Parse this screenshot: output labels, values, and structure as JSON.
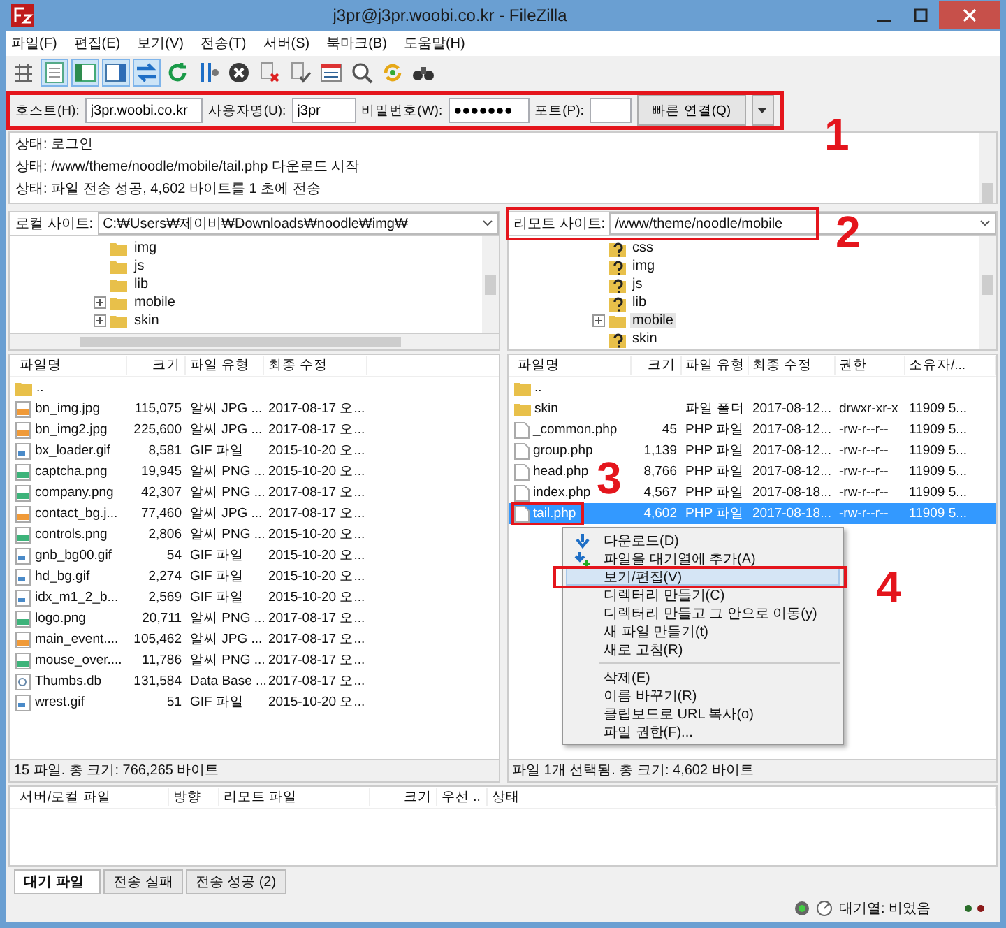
{
  "window": {
    "title": "j3pr@j3pr.woobi.co.kr - FileZilla"
  },
  "menu": [
    "파일(F)",
    "편집(E)",
    "보기(V)",
    "전송(T)",
    "서버(S)",
    "북마크(B)",
    "도움말(H)"
  ],
  "toolbar": [
    {
      "kind": "sites",
      "pressed": false
    },
    {
      "kind": "log",
      "pressed": true
    },
    {
      "kind": "localtree",
      "pressed": true
    },
    {
      "kind": "remotetree",
      "pressed": true
    },
    {
      "kind": "queue",
      "pressed": true
    },
    {
      "kind": "refresh",
      "pressed": false
    },
    {
      "kind": "process",
      "pressed": false
    },
    {
      "kind": "cancel",
      "pressed": false
    },
    {
      "kind": "disconnect",
      "pressed": false
    },
    {
      "kind": "reconnect",
      "pressed": false
    },
    {
      "kind": "filter",
      "pressed": false
    },
    {
      "kind": "compare",
      "pressed": false
    },
    {
      "kind": "sync",
      "pressed": false
    },
    {
      "kind": "find",
      "pressed": false
    }
  ],
  "quickconnect": {
    "fields": [
      {
        "label": "호스트(H):",
        "value": "j3pr.woobi.co.kr"
      },
      {
        "label": "사용자명(U):",
        "value": "j3pr"
      },
      {
        "label": "비밀번호(W):",
        "value": "●●●●●●●"
      },
      {
        "label": "포트(P):"
      }
    ],
    "button": "빠른 연결(Q)"
  },
  "log": [
    {
      "prefix": "상태:",
      "text": "로그인"
    },
    {
      "prefix": "상태:",
      "text": "/www/theme/noodle/mobile/tail.php 다운로드 시작"
    },
    {
      "prefix": "상태:",
      "text": "파일 전송 성공, 4,602 바이트를 1 초에 전송"
    }
  ],
  "local": {
    "label": "로컬 사이트:",
    "path": "C:₩Users₩제이비₩Downloads₩noodle₩img₩",
    "tree": [
      {
        "name": "img",
        "kind": "folder",
        "expandable": false,
        "selected": false
      },
      {
        "name": "js",
        "kind": "folder",
        "expandable": false,
        "selected": false
      },
      {
        "name": "lib",
        "kind": "folder",
        "expandable": false,
        "selected": false
      },
      {
        "name": "mobile",
        "kind": "folder",
        "expandable": true,
        "selected": false
      },
      {
        "name": "skin",
        "kind": "folder",
        "expandable": true,
        "selected": false
      }
    ],
    "columns": [
      "파일명",
      "크기",
      "파일 유형",
      "최종 수정"
    ],
    "rows": [
      {
        "kind": "folder",
        "cells": [
          ".."
        ],
        "selected": false
      },
      {
        "kind": "jpg",
        "cells": [
          "bn_img.jpg",
          "115,075",
          "알씨 JPG ...",
          "2017-08-17 오..."
        ],
        "selected": false
      },
      {
        "kind": "jpg",
        "cells": [
          "bn_img2.jpg",
          "225,600",
          "알씨 JPG ...",
          "2017-08-17 오..."
        ],
        "selected": false
      },
      {
        "kind": "gif",
        "cells": [
          "bx_loader.gif",
          "8,581",
          "GIF 파일",
          "2015-10-20 오..."
        ],
        "selected": false
      },
      {
        "kind": "png",
        "cells": [
          "captcha.png",
          "19,945",
          "알씨 PNG ...",
          "2015-10-20 오..."
        ],
        "selected": false
      },
      {
        "kind": "png",
        "cells": [
          "company.png",
          "42,307",
          "알씨 PNG ...",
          "2017-08-17 오..."
        ],
        "selected": false
      },
      {
        "kind": "jpg",
        "cells": [
          "contact_bg.j...",
          "77,460",
          "알씨 JPG ...",
          "2017-08-17 오..."
        ],
        "selected": false
      },
      {
        "kind": "png",
        "cells": [
          "controls.png",
          "2,806",
          "알씨 PNG ...",
          "2015-10-20 오..."
        ],
        "selected": false
      },
      {
        "kind": "gif",
        "cells": [
          "gnb_bg00.gif",
          "54",
          "GIF 파일",
          "2015-10-20 오..."
        ],
        "selected": false
      },
      {
        "kind": "gif",
        "cells": [
          "hd_bg.gif",
          "2,274",
          "GIF 파일",
          "2015-10-20 오..."
        ],
        "selected": false
      },
      {
        "kind": "gif",
        "cells": [
          "idx_m1_2_b...",
          "2,569",
          "GIF 파일",
          "2015-10-20 오..."
        ],
        "selected": false
      },
      {
        "kind": "png",
        "cells": [
          "logo.png",
          "20,711",
          "알씨 PNG ...",
          "2017-08-17 오..."
        ],
        "selected": false
      },
      {
        "kind": "jpg",
        "cells": [
          "main_event....",
          "105,462",
          "알씨 JPG ...",
          "2017-08-17 오..."
        ],
        "selected": false
      },
      {
        "kind": "png",
        "cells": [
          "mouse_over....",
          "11,786",
          "알씨 PNG ...",
          "2017-08-17 오..."
        ],
        "selected": false
      },
      {
        "kind": "db",
        "cells": [
          "Thumbs.db",
          "131,584",
          "Data Base ...",
          "2017-08-17 오..."
        ],
        "selected": false
      },
      {
        "kind": "gif",
        "cells": [
          "wrest.gif",
          "51",
          "GIF 파일",
          "2015-10-20 오..."
        ],
        "selected": false
      }
    ],
    "status": "15 파일. 총 크기: 766,265 바이트"
  },
  "remote": {
    "label": "리모트 사이트:",
    "path": "/www/theme/noodle/mobile",
    "tree": [
      {
        "name": "css",
        "kind": "unknown",
        "expandable": false,
        "selected": false
      },
      {
        "name": "img",
        "kind": "unknown",
        "expandable": false,
        "selected": false
      },
      {
        "name": "js",
        "kind": "unknown",
        "expandable": false,
        "selected": false
      },
      {
        "name": "lib",
        "kind": "unknown",
        "expandable": false,
        "selected": false
      },
      {
        "name": "mobile",
        "kind": "folder",
        "expandable": true,
        "selected": true
      },
      {
        "name": "skin",
        "kind": "unknown",
        "expandable": false,
        "selected": false
      }
    ],
    "columns": [
      "파일명",
      "크기",
      "파일 유형",
      "최종 수정",
      "권한",
      "소유자/..."
    ],
    "rows": [
      {
        "kind": "folder",
        "cells": [
          ".."
        ],
        "selected": false
      },
      {
        "kind": "folder",
        "cells": [
          "skin",
          "",
          "파일 폴더",
          "2017-08-12...",
          "drwxr-xr-x",
          "11909 5..."
        ],
        "selected": false
      },
      {
        "kind": "php",
        "cells": [
          "_common.php",
          "45",
          "PHP 파일",
          "2017-08-12...",
          "-rw-r--r--",
          "11909 5..."
        ],
        "selected": false
      },
      {
        "kind": "php",
        "cells": [
          "group.php",
          "1,139",
          "PHP 파일",
          "2017-08-12...",
          "-rw-r--r--",
          "11909 5..."
        ],
        "selected": false
      },
      {
        "kind": "php",
        "cells": [
          "head.php",
          "8,766",
          "PHP 파일",
          "2017-08-12...",
          "-rw-r--r--",
          "11909 5..."
        ],
        "selected": false
      },
      {
        "kind": "php",
        "cells": [
          "index.php",
          "4,567",
          "PHP 파일",
          "2017-08-18...",
          "-rw-r--r--",
          "11909 5..."
        ],
        "selected": false
      },
      {
        "kind": "php",
        "cells": [
          "tail.php",
          "4,602",
          "PHP 파일",
          "2017-08-18...",
          "-rw-r--r--",
          "11909 5..."
        ],
        "selected": true
      }
    ],
    "status": "파일 1개 선택됨. 총 크기: 4,602 바이트"
  },
  "context_menu": [
    {
      "kind": "download",
      "label": "다운로드(D)",
      "selected": false
    },
    {
      "kind": "queue",
      "label": "파일을 대기열에 추가(A)",
      "selected": false
    },
    {
      "kind": "item",
      "label": "보기/편집(V)",
      "selected": true
    },
    {
      "kind": "item",
      "label": "디렉터리 만들기(C)",
      "selected": false
    },
    {
      "kind": "item",
      "label": "디렉터리 만들고 그 안으로 이동(y)",
      "selected": false
    },
    {
      "kind": "item",
      "label": "새 파일 만들기(t)",
      "selected": false
    },
    {
      "kind": "item",
      "label": "새로 고침(R)",
      "selected": false
    },
    {
      "kind": "separator"
    },
    {
      "kind": "item",
      "label": "삭제(E)",
      "selected": false
    },
    {
      "kind": "item",
      "label": "이름 바꾸기(R)",
      "selected": false
    },
    {
      "kind": "item",
      "label": "클립보드로 URL 복사(o)",
      "selected": false
    },
    {
      "kind": "item",
      "label": "파일 권한(F)...",
      "selected": false
    }
  ],
  "queue": {
    "columns": [
      "서버/로컬 파일",
      "방향",
      "리모트 파일",
      "크기",
      "우선 ..",
      "상태"
    ],
    "tabs": [
      {
        "label": "대기 파일",
        "selected": true
      },
      {
        "label": "전송 실패",
        "selected": false
      },
      {
        "label": "전송 성공 (2)",
        "selected": false
      }
    ]
  },
  "status_bar": {
    "queue": "대기열: 비었음"
  },
  "annotations": [
    {
      "label": "1"
    },
    {
      "label": "2"
    },
    {
      "label": "3"
    },
    {
      "label": "4"
    }
  ]
}
